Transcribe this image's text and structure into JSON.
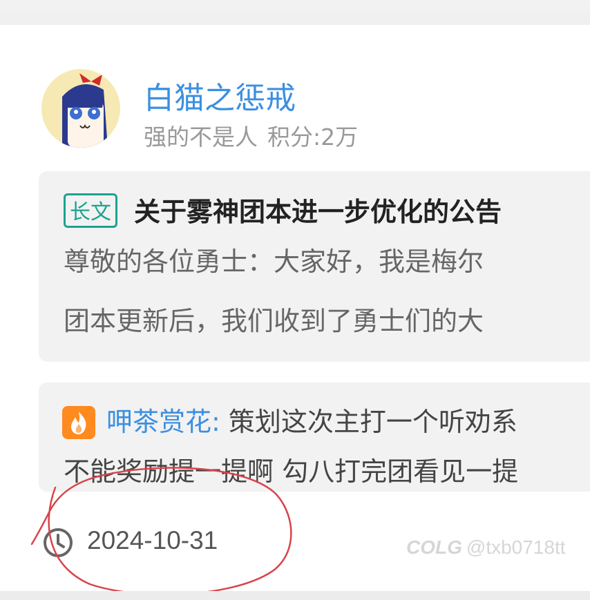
{
  "user": {
    "name": "白猫之惩戒",
    "title": "强的不是人",
    "score": "积分:2万"
  },
  "post": {
    "tag": "长文",
    "title": "关于雾神团本进一步优化的公告",
    "line1": "尊敬的各位勇士：大家好，我是梅尔",
    "line2": "团本更新后，我们收到了勇士们的大"
  },
  "comment": {
    "author": "呷茶赏花:",
    "line1": "策划这次主打一个听劝系",
    "line2": "不能奖励提一提啊 勾八打完团看见一提"
  },
  "footer": {
    "date": "2024-10-31"
  },
  "watermark": {
    "logo": "COLG",
    "handle": "@txb0718tt"
  },
  "colors": {
    "accent_blue": "#3b8fe0",
    "tag_teal": "#1aa391",
    "fire_orange": "#ff8a1f",
    "annotation_red": "#d9434a"
  },
  "icons": {
    "clock": "clock-icon",
    "fire": "fire-icon"
  }
}
